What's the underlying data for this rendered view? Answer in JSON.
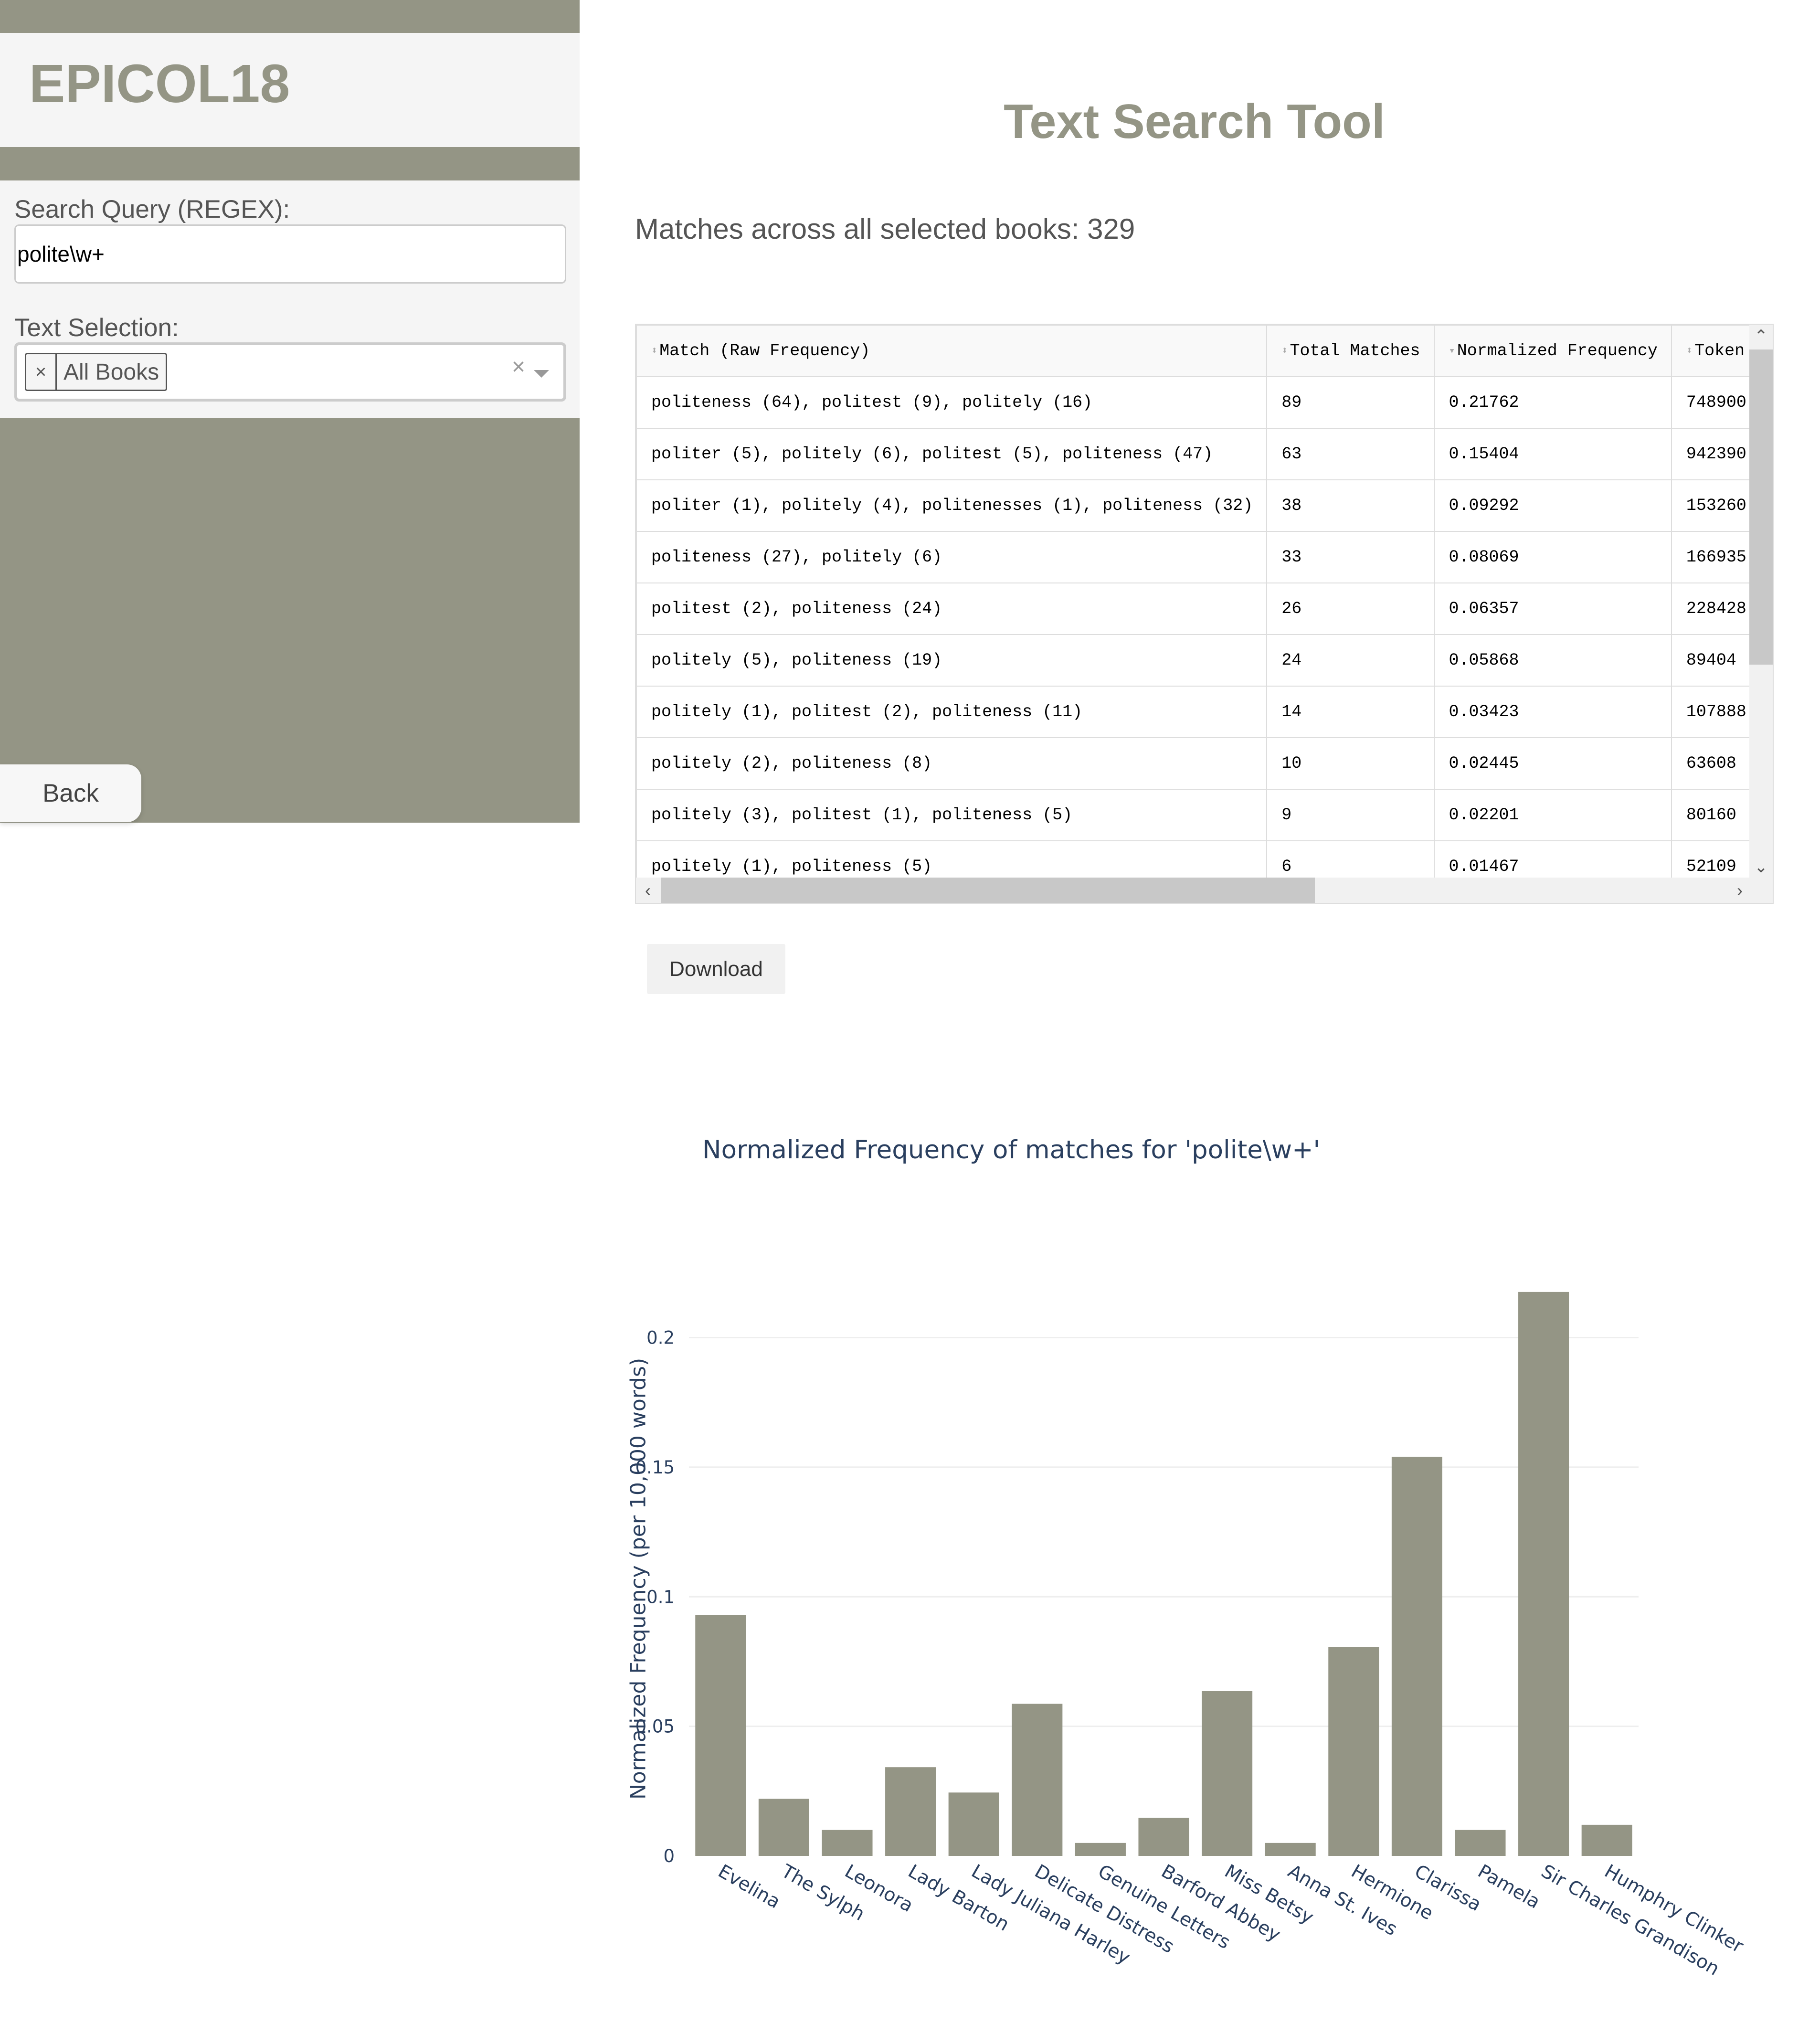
{
  "sidebar": {
    "logo": "EPICOL18",
    "search_label": "Search Query (REGEX):",
    "search_value": "polite\\w+",
    "selection_label": "Text Selection:",
    "selected_chip": "All Books",
    "chip_remove": "×",
    "clear_all": "×",
    "back_label": "Back"
  },
  "main": {
    "title": "Text Search Tool",
    "summary": "Matches across all selected books: 329"
  },
  "table": {
    "columns": [
      "Match (Raw Frequency)",
      "Total Matches",
      "Normalized Frequency",
      "Token Tot"
    ],
    "rows": [
      [
        "politeness (64), politest (9), politely (16)",
        "89",
        "0.21762",
        "748900"
      ],
      [
        "politer (5), politely (6), politest (5), politeness (47)",
        "63",
        "0.15404",
        "942390"
      ],
      [
        "politer (1), politely (4), politenesses (1), politeness (32)",
        "38",
        "0.09292",
        "153260"
      ],
      [
        "politeness (27), politely (6)",
        "33",
        "0.08069",
        "166935"
      ],
      [
        "politest (2), politeness (24)",
        "26",
        "0.06357",
        "228428"
      ],
      [
        "politely (5), politeness (19)",
        "24",
        "0.05868",
        "89404"
      ],
      [
        "politely (1), politest (2), politeness (11)",
        "14",
        "0.03423",
        "107888"
      ],
      [
        "politely (2), politeness (8)",
        "10",
        "0.02445",
        "63608"
      ],
      [
        "politely (3), politest (1), politeness (5)",
        "9",
        "0.02201",
        "80160"
      ],
      [
        "politely (1), politeness (5)",
        "6",
        "0.01467",
        "52109"
      ]
    ],
    "download_label": "Download"
  },
  "chart_data": {
    "type": "bar",
    "title": "Normalized Frequency of matches for 'polite\\w+'",
    "xlabel": "",
    "ylabel": "Normalized Frequency (per 10,000 words)",
    "categories": [
      "Evelina",
      "The Sylph",
      "Leonora",
      "Lady Barton",
      "Lady Juliana Harley",
      "Delicate Distress",
      "Genuine Letters",
      "Barford Abbey",
      "Miss Betsy",
      "Anna St. Ives",
      "Hermione",
      "Clarissa",
      "Pamela",
      "Sir Charles Grandison",
      "Humphry Clinker"
    ],
    "values": [
      0.09292,
      0.02201,
      0.01,
      0.03423,
      0.02445,
      0.05868,
      0.005,
      0.01467,
      0.06357,
      0.005,
      0.08069,
      0.15404,
      0.01,
      0.21762,
      0.012
    ],
    "ylim": [
      0,
      0.2176
    ],
    "yticks": [
      0,
      0.05,
      0.1,
      0.15,
      0.2
    ],
    "ytick_labels": [
      "0",
      "0.05",
      "0.1",
      "0.15",
      "0.2"
    ],
    "grid": true,
    "bar_color": "#949585"
  },
  "colors": {
    "accent": "#949585",
    "panel": "#f5f5f5",
    "chart_text": "#2a3f5f"
  }
}
